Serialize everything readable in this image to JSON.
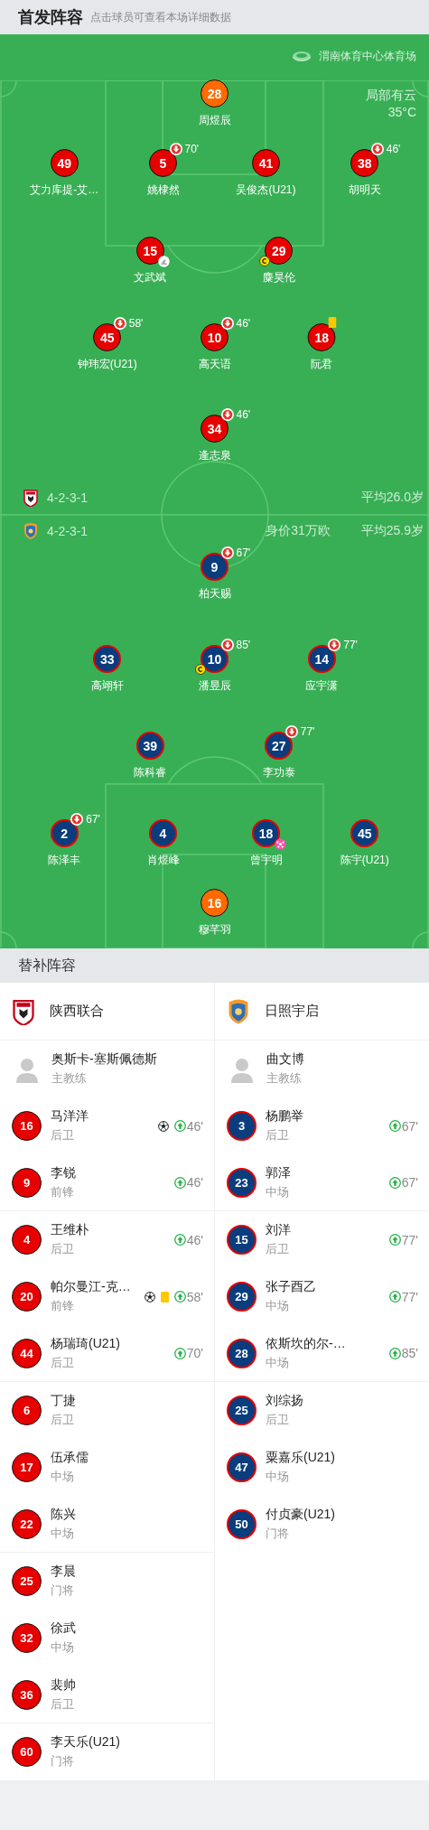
{
  "header": {
    "title": "首发阵容",
    "hint": "点击球员可查看本场详细数据"
  },
  "pitch": {
    "venue": "渭南体育中心体育场",
    "weather": "局部有云",
    "temperature": "35°C",
    "home": {
      "formation": "4-2-3-1",
      "average_age": "平均26.0岁",
      "lines": [
        [
          {
            "number": "28",
            "name": "周煜辰",
            "kind": "goalkeeper"
          }
        ],
        [
          {
            "number": "49",
            "name": "艾力库提-艾…",
            "kind": "outfield"
          },
          {
            "number": "5",
            "name": "姚棣然",
            "kind": "outfield",
            "events": [
              {
                "kind": "sub_off",
                "time": "70'"
              }
            ]
          },
          {
            "number": "41",
            "name": "吴俊杰(U21)",
            "kind": "outfield"
          },
          {
            "number": "38",
            "name": "胡明天",
            "kind": "outfield",
            "events": [
              {
                "kind": "sub_off",
                "time": "46'"
              }
            ]
          }
        ],
        [
          {
            "number": "15",
            "name": "文武斌",
            "kind": "outfield",
            "events": [
              {
                "kind": "assist"
              }
            ]
          },
          {
            "number": "29",
            "name": "麋昊伦",
            "kind": "outfield",
            "events": [
              {
                "kind": "captain"
              }
            ]
          }
        ],
        [
          {
            "number": "45",
            "name": "钟玮宏(U21)",
            "kind": "outfield",
            "events": [
              {
                "kind": "sub_off",
                "time": "58'"
              }
            ]
          },
          {
            "number": "10",
            "name": "高天语",
            "kind": "outfield",
            "events": [
              {
                "kind": "sub_off",
                "time": "46'"
              }
            ]
          },
          {
            "number": "18",
            "name": "阮君",
            "kind": "outfield",
            "events": [
              {
                "kind": "yellow"
              }
            ]
          }
        ],
        [
          {
            "number": "34",
            "name": "逄志泉",
            "kind": "outfield",
            "events": [
              {
                "kind": "sub_off",
                "time": "46'"
              }
            ]
          }
        ]
      ]
    },
    "away": {
      "formation": "4-2-3-1",
      "market_value": "身价31万欧",
      "average_age": "平均25.9岁",
      "lines": [
        [
          {
            "number": "9",
            "name": "柏天赐",
            "kind": "outfield",
            "events": [
              {
                "kind": "sub_off",
                "time": "67'"
              }
            ]
          }
        ],
        [
          {
            "number": "33",
            "name": "高翊轩",
            "kind": "outfield"
          },
          {
            "number": "10",
            "name": "潘昱辰",
            "kind": "outfield",
            "events": [
              {
                "kind": "sub_off",
                "time": "85'"
              },
              {
                "kind": "captain"
              }
            ]
          },
          {
            "number": "14",
            "name": "应宇潇",
            "kind": "outfield",
            "events": [
              {
                "kind": "sub_off",
                "time": "77'"
              }
            ]
          }
        ],
        [
          {
            "number": "39",
            "name": "陈科睿",
            "kind": "outfield"
          },
          {
            "number": "27",
            "name": "李功泰",
            "kind": "outfield",
            "events": [
              {
                "kind": "sub_off",
                "time": "77'"
              }
            ]
          }
        ],
        [
          {
            "number": "2",
            "name": "陈泽丰",
            "kind": "outfield",
            "events": [
              {
                "kind": "sub_off",
                "time": "67'"
              }
            ]
          },
          {
            "number": "4",
            "name": "肖煜峰",
            "kind": "outfield"
          },
          {
            "number": "18",
            "name": "曾宇明",
            "kind": "outfield",
            "events": [
              {
                "kind": "own_goal"
              }
            ]
          },
          {
            "number": "45",
            "name": "陈宇(U21)",
            "kind": "outfield"
          }
        ],
        [
          {
            "number": "16",
            "name": "穆芊羽",
            "kind": "goalkeeper"
          }
        ]
      ]
    }
  },
  "substitutes": {
    "title": "替补阵容",
    "teams": [
      {
        "name": "陕西联合",
        "coach": {
          "name": "奥斯卡-塞斯佩德斯",
          "role": "主教练"
        },
        "players": [
          {
            "number": "16",
            "name": "马洋洋",
            "position": "后卫",
            "events": [
              {
                "kind": "goal"
              },
              {
                "kind": "sub_in",
                "time": "46'"
              }
            ]
          },
          {
            "number": "9",
            "name": "李锐",
            "position": "前锋",
            "events": [
              {
                "kind": "sub_in",
                "time": "46'"
              }
            ]
          },
          {
            "number": "4",
            "name": "王维朴",
            "position": "后卫",
            "events": [
              {
                "kind": "sub_in",
                "time": "46'"
              }
            ]
          },
          {
            "number": "20",
            "name": "帕尔曼江-克…",
            "position": "前锋",
            "events": [
              {
                "kind": "goal"
              },
              {
                "kind": "yellow"
              },
              {
                "kind": "sub_in",
                "time": "58'"
              }
            ]
          },
          {
            "number": "44",
            "name": "杨瑞琦(U21)",
            "position": "后卫",
            "events": [
              {
                "kind": "sub_in",
                "time": "70'"
              }
            ]
          },
          {
            "number": "6",
            "name": "丁捷",
            "position": "后卫"
          },
          {
            "number": "17",
            "name": "伍承儒",
            "position": "中场"
          },
          {
            "number": "22",
            "name": "陈兴",
            "position": "中场"
          },
          {
            "number": "25",
            "name": "李晨",
            "position": "门将"
          },
          {
            "number": "32",
            "name": "徐武",
            "position": "中场"
          },
          {
            "number": "36",
            "name": "裴帅",
            "position": "后卫"
          },
          {
            "number": "60",
            "name": "李天乐(U21)",
            "position": "门将"
          }
        ]
      },
      {
        "name": "日照宇启",
        "coach": {
          "name": "曲文博",
          "role": "主教练"
        },
        "players": [
          {
            "number": "3",
            "name": "杨鹏举",
            "position": "后卫",
            "events": [
              {
                "kind": "sub_in",
                "time": "67'"
              }
            ]
          },
          {
            "number": "23",
            "name": "郭泽",
            "position": "中场",
            "events": [
              {
                "kind": "sub_in",
                "time": "67'"
              }
            ]
          },
          {
            "number": "15",
            "name": "刘洋",
            "position": "后卫",
            "events": [
              {
                "kind": "sub_in",
                "time": "77'"
              }
            ]
          },
          {
            "number": "29",
            "name": "张子酉乙",
            "position": "中场",
            "events": [
              {
                "kind": "sub_in",
                "time": "77'"
              }
            ]
          },
          {
            "number": "28",
            "name": "依斯坎的尔-…",
            "position": "中场",
            "events": [
              {
                "kind": "sub_in",
                "time": "85'"
              }
            ]
          },
          {
            "number": "25",
            "name": "刘综扬",
            "position": "后卫"
          },
          {
            "number": "47",
            "name": "粟嘉乐(U21)",
            "position": "中场"
          },
          {
            "number": "50",
            "name": "付贞豪(U21)",
            "position": "门将"
          }
        ]
      }
    ]
  }
}
